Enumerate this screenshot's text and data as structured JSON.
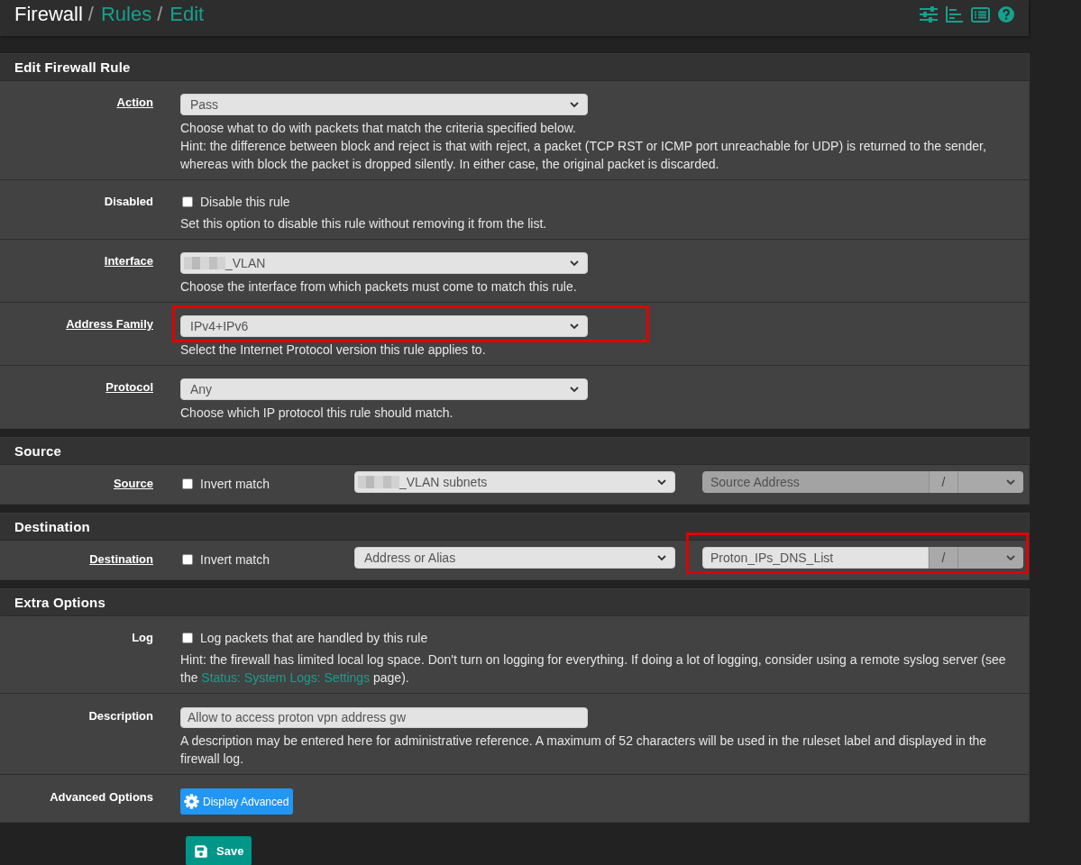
{
  "header": {
    "breadcrumb": [
      {
        "text": "Firewall",
        "link": false,
        "separator": "/"
      },
      {
        "text": "Rules",
        "link": true,
        "separator": "/"
      },
      {
        "text": "Edit",
        "link": true
      }
    ]
  },
  "panels": [
    {
      "title": "Edit Firewall Rule",
      "rows": [
        {
          "kind": "select",
          "label": "Action",
          "underlined": true,
          "value": "Pass",
          "redacted": false,
          "highlighted": false,
          "help": [
            {
              "text": "Choose what to do with packets that match the criteria specified below."
            },
            {
              "text": "Hint: the difference between block and reject is that with reject, a packet (TCP RST or ICMP port unreachable for UDP) is returned to the sender, whereas with block the packet is dropped silently. In either case, the original packet is discarded."
            }
          ]
        },
        {
          "kind": "checkbox",
          "label": "Disabled",
          "underlined": false,
          "option": "Disable this rule",
          "checked": false,
          "help": [
            {
              "text": "Set this option to disable this rule without removing it from the list."
            }
          ]
        },
        {
          "kind": "select",
          "label": "Interface",
          "underlined": true,
          "value": "_VLAN",
          "redacted": true,
          "highlighted": false,
          "help": [
            {
              "text": "Choose the interface from which packets must come to match this rule."
            }
          ]
        },
        {
          "kind": "select",
          "label": "Address Family",
          "underlined": true,
          "value": "IPv4+IPv6",
          "redacted": false,
          "highlighted": true,
          "help": [
            {
              "text": "Select the Internet Protocol version this rule applies to."
            }
          ]
        },
        {
          "kind": "select",
          "label": "Protocol",
          "underlined": true,
          "value": "Any",
          "redacted": false,
          "highlighted": false,
          "help": [
            {
              "text": "Choose which IP protocol this rule should match."
            }
          ]
        }
      ]
    },
    {
      "title": "Source",
      "rows": [
        {
          "kind": "address",
          "label": "Source",
          "underlined": true,
          "invert": {
            "label": "Invert match",
            "checked": false
          },
          "type": {
            "value": "_VLAN subnets",
            "redacted": true
          },
          "address": {
            "placeholder": "Source Address",
            "disabled": true,
            "highlighted": false
          },
          "separator": "/",
          "mask": {
            "disabled": true
          }
        }
      ]
    },
    {
      "title": "Destination",
      "rows": [
        {
          "kind": "address",
          "label": "Destination",
          "underlined": true,
          "invert": {
            "label": "Invert match",
            "checked": false
          },
          "type": {
            "value": "Address or Alias",
            "redacted": false
          },
          "address": {
            "value": "Proton_IPs_DNS_List",
            "disabled": false,
            "highlighted": true
          },
          "separator": "/",
          "mask": {
            "disabled": true
          }
        }
      ]
    },
    {
      "title": "Extra Options",
      "rows": [
        {
          "kind": "checkbox",
          "label": "Log",
          "underlined": false,
          "option": "Log packets that are handled by this rule",
          "checked": false,
          "help": [
            {
              "text": "Hint: the firewall has limited local log space. Don't turn on logging for everything. If doing a lot of logging, consider using a remote syslog server (see the ",
              "link": "Status: System Logs: Settings",
              "after": " page)."
            }
          ]
        },
        {
          "kind": "text",
          "label": "Description",
          "underlined": false,
          "value": "Allow to access proton vpn address gw",
          "help": [
            {
              "text": "A description may be entered here for administrative reference. A maximum of 52 characters will be used in the ruleset label and displayed in the firewall log."
            }
          ]
        },
        {
          "kind": "button",
          "label": "Advanced Options",
          "underlined": false,
          "button": "Display Advanced"
        }
      ]
    }
  ],
  "save_button": {
    "label": "Save"
  }
}
